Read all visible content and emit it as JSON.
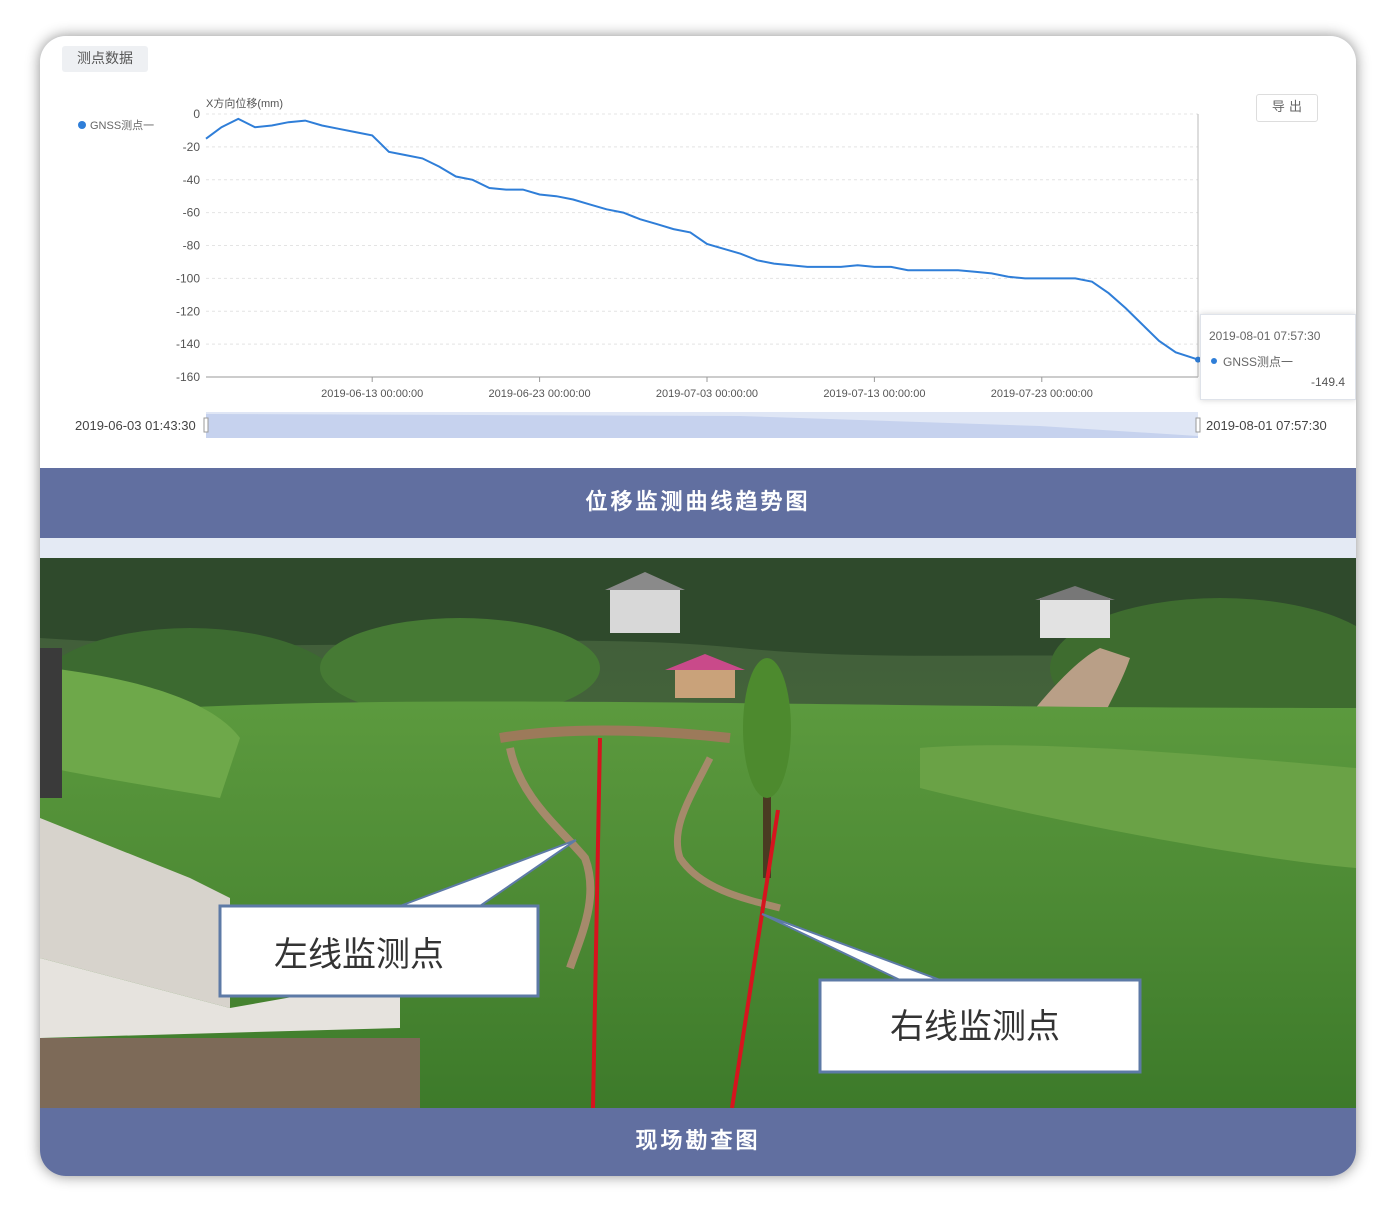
{
  "panel_tab": "测点数据",
  "export_label": "导 出",
  "caption_chart": "位移监测曲线趋势图",
  "caption_photo": "现场勘查图",
  "chart_data": {
    "type": "line",
    "ylabel": "X方向位移(mm)",
    "ylim": [
      -160,
      0
    ],
    "y_ticks": [
      0,
      -20,
      -40,
      -60,
      -80,
      -100,
      -120,
      -140,
      -160
    ],
    "x_tick_labels": [
      "2019-06-13 00:00:00",
      "2019-06-23 00:00:00",
      "2019-07-03 00:00:00",
      "2019-07-13 00:00:00",
      "2019-07-23 00:00:00"
    ],
    "x_range": [
      "2019-06-03 01:43:30",
      "2019-08-01 07:57:30"
    ],
    "grid": "horizontal dashed",
    "legend": "top-left",
    "color": "#2f7ed8",
    "series": [
      {
        "name": "GNSS测点一",
        "points": [
          [
            "2019-06-03",
            -15
          ],
          [
            "2019-06-04",
            -8
          ],
          [
            "2019-06-05",
            -3
          ],
          [
            "2019-06-06",
            -8
          ],
          [
            "2019-06-07",
            -7
          ],
          [
            "2019-06-08",
            -5
          ],
          [
            "2019-06-09",
            -4
          ],
          [
            "2019-06-10",
            -7
          ],
          [
            "2019-06-11",
            -9
          ],
          [
            "2019-06-12",
            -11
          ],
          [
            "2019-06-13",
            -13
          ],
          [
            "2019-06-14",
            -23
          ],
          [
            "2019-06-15",
            -25
          ],
          [
            "2019-06-16",
            -27
          ],
          [
            "2019-06-17",
            -32
          ],
          [
            "2019-06-18",
            -38
          ],
          [
            "2019-06-19",
            -40
          ],
          [
            "2019-06-20",
            -45
          ],
          [
            "2019-06-21",
            -46
          ],
          [
            "2019-06-22",
            -46
          ],
          [
            "2019-06-23",
            -49
          ],
          [
            "2019-06-24",
            -50
          ],
          [
            "2019-06-25",
            -52
          ],
          [
            "2019-06-26",
            -55
          ],
          [
            "2019-06-27",
            -58
          ],
          [
            "2019-06-28",
            -60
          ],
          [
            "2019-06-29",
            -64
          ],
          [
            "2019-06-30",
            -67
          ],
          [
            "2019-07-01",
            -70
          ],
          [
            "2019-07-02",
            -72
          ],
          [
            "2019-07-03",
            -79
          ],
          [
            "2019-07-04",
            -82
          ],
          [
            "2019-07-05",
            -85
          ],
          [
            "2019-07-06",
            -89
          ],
          [
            "2019-07-07",
            -91
          ],
          [
            "2019-07-08",
            -92
          ],
          [
            "2019-07-09",
            -93
          ],
          [
            "2019-07-10",
            -93
          ],
          [
            "2019-07-11",
            -93
          ],
          [
            "2019-07-12",
            -92
          ],
          [
            "2019-07-13",
            -93
          ],
          [
            "2019-07-14",
            -93
          ],
          [
            "2019-07-15",
            -95
          ],
          [
            "2019-07-16",
            -95
          ],
          [
            "2019-07-17",
            -95
          ],
          [
            "2019-07-18",
            -95
          ],
          [
            "2019-07-19",
            -96
          ],
          [
            "2019-07-20",
            -97
          ],
          [
            "2019-07-21",
            -99
          ],
          [
            "2019-07-22",
            -100
          ],
          [
            "2019-07-23",
            -100
          ],
          [
            "2019-07-24",
            -100
          ],
          [
            "2019-07-25",
            -100
          ],
          [
            "2019-07-26",
            -102
          ],
          [
            "2019-07-27",
            -109
          ],
          [
            "2019-07-28",
            -118
          ],
          [
            "2019-07-29",
            -128
          ],
          [
            "2019-07-30",
            -138
          ],
          [
            "2019-07-31",
            -145
          ],
          [
            "2019-08-01",
            -149.4
          ]
        ]
      }
    ]
  },
  "tooltip": {
    "time": "2019-08-01 07:57:30",
    "series_name": "GNSS测点一",
    "value": "-149.4"
  },
  "range": {
    "start": "2019-06-03 01:43:30",
    "end": "2019-08-01 07:57:30"
  },
  "photo_labels": {
    "left": "左线监测点",
    "right": "右线监测点"
  }
}
